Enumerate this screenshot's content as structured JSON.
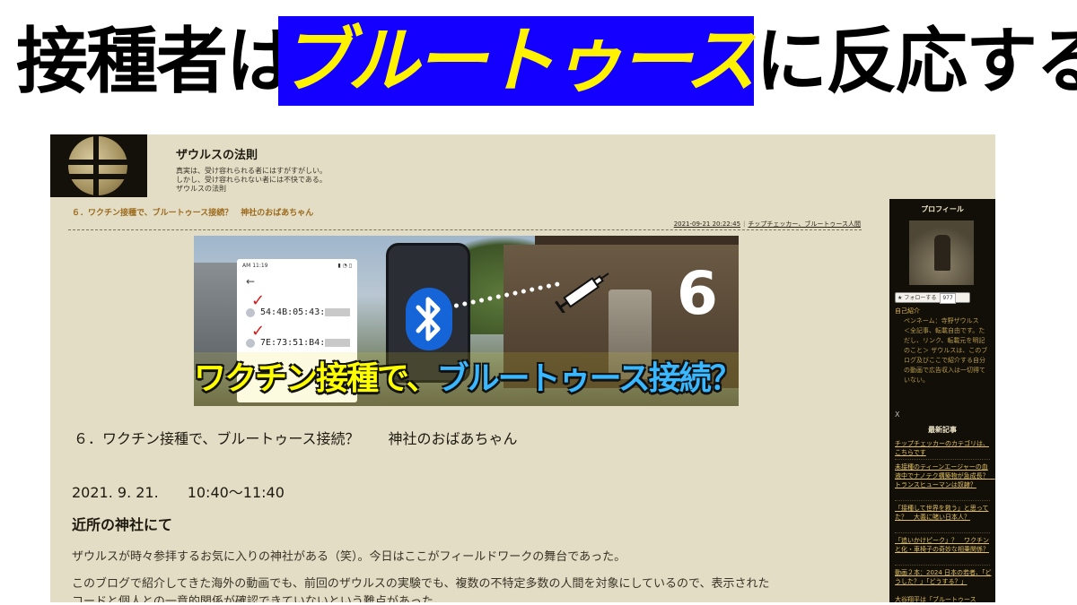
{
  "headline": {
    "pre": "接種者は",
    "highlight": "ブルートゥース",
    "post": "に反応する",
    "colors": {
      "highlight_bg": "#1400ff",
      "highlight_text": "#fff200"
    }
  },
  "blog": {
    "title": "ザウルスの法則",
    "tagline": [
      "真実は、受け容れられる者にはすがすがしい。",
      "しかし、受け容れられない者には不快である。",
      "ザウルスの法則"
    ]
  },
  "post": {
    "heading": "６．ワクチン接種で、ブルートゥース接続？　神社のおばあちゃん",
    "timestamp": "2021-09-21 20:22:45",
    "category": "チップチェッカー、ブルートゥース人間",
    "hero": {
      "phone_time": "AM 11:19",
      "device_1": "54:4B:05:43:",
      "device_2": "7E:73:51:B4:",
      "big_number": "6",
      "caption_a": "ワクチン接種で、",
      "caption_b": "ブルートゥース接続？",
      "icons": [
        "bluetooth-icon",
        "syringe-icon",
        "check-icon"
      ]
    },
    "title": "６．ワクチン接種で、ブルートゥース接続？　　神社のおばあちゃん",
    "date": "2021. 9. 21.　　10:40〜11:40",
    "section": "近所の神社にて",
    "paragraphs": [
      "ザウルスが時々参拝するお気に入りの神社がある（笑）。今日はここがフィールドワークの舞台であった。",
      "このブログで紹介してきた海外の動画でも、前回のザウルスの実験でも、複数の不特定多数の人間を対象にしているので、表示された",
      "コードと個人との一意的関係が確認できていないという難点があった。"
    ]
  },
  "sidebar": {
    "profile_heading": "プロフィール",
    "follow_label": "フォローする",
    "follow_count": "977",
    "intro_label": "自己紹介",
    "intro_text": "ペンネーム：寺野ザウルス　＜全記事、転載自由です。ただし、リンク、転載元を明記のこと＞ ザウルスは、このブログ及びここで紹介する自分の動画で広告収入は一切得ていない。",
    "x_label": "X",
    "recent_heading": "最新記事",
    "recent_posts": [
      "チップチェッカーのカテゴリは、こちらです",
      "未接種のティーンエージャーの血液中でナノテク構築物が急成長？　トランスヒューマンは奴隷？",
      "「接種して世界を救う」と思ってた？　大義に賭い日本人？",
      "「追いかけピーク」？　ワクチンと化・車椅子の奇妙な相乗関係？",
      "動画２本：2024 日本の若者、「どうした？」「どうする？」",
      "大谷翔平は「ブルートゥース"
    ],
    "colors": {
      "background": "#120e08",
      "link": "#e0c060"
    }
  },
  "page_colors": {
    "page_bg": "#e3ddc6",
    "post_heading": "#9c6a1b"
  }
}
